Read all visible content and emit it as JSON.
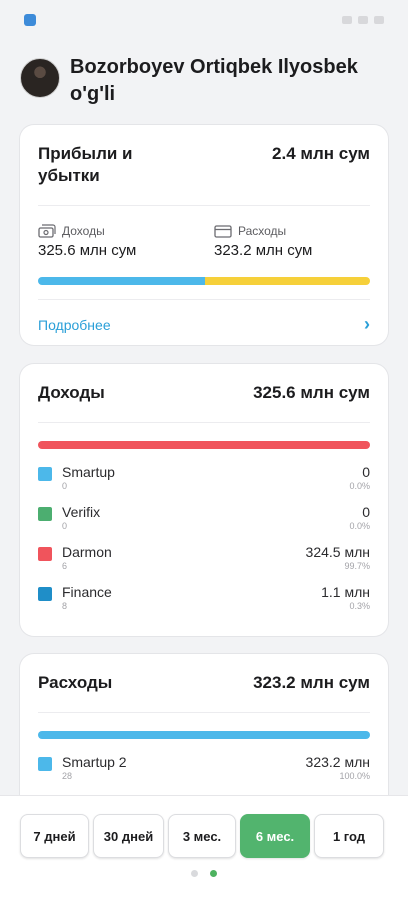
{
  "colors": {
    "accent_blue": "#4cb8ea",
    "accent_yellow": "#f6d03a",
    "red": "#f0545c",
    "green": "#4cae70",
    "dark_blue": "#1f8ec8",
    "active_period": "#52b46e"
  },
  "profile": {
    "name": "Bozorboyev Ortiqbek Ilyosbek o'g'li"
  },
  "profit_loss": {
    "title": "Прибыли и убытки",
    "total": "2.4 млн сум",
    "income_label": "Доходы",
    "income_icon": "cash-icon",
    "income_value": "325.6 млн сум",
    "expense_label": "Расходы",
    "expense_icon": "card-icon",
    "expense_value": "323.2 млн сум",
    "income_share": 0.502,
    "more_label": "Подробнее"
  },
  "income": {
    "title": "Доходы",
    "total": "325.6 млн сум",
    "items": [
      {
        "name": "Smartup",
        "count": "0",
        "value": "0",
        "percent": "0.0%",
        "color": "#4cb8ea"
      },
      {
        "name": "Verifix",
        "count": "0",
        "value": "0",
        "percent": "0.0%",
        "color": "#4cae70"
      },
      {
        "name": "Darmon",
        "count": "6",
        "value": "324.5 млн",
        "percent": "99.7%",
        "color": "#f0545c"
      },
      {
        "name": "Finance",
        "count": "8",
        "value": "1.1 млн",
        "percent": "0.3%",
        "color": "#1f8ec8"
      }
    ]
  },
  "expenses": {
    "title": "Расходы",
    "total": "323.2 млн сум",
    "items": [
      {
        "name": "Smartup 2",
        "count": "28",
        "value": "323.2 млн",
        "percent": "100.0%",
        "color": "#4cb8ea"
      }
    ]
  },
  "periods": {
    "items": [
      "7 дней",
      "30 дней",
      "3 мес.",
      "6 мес.",
      "1 год"
    ],
    "active_index": 3
  },
  "pager": {
    "pages": 2,
    "active_index": 1
  }
}
